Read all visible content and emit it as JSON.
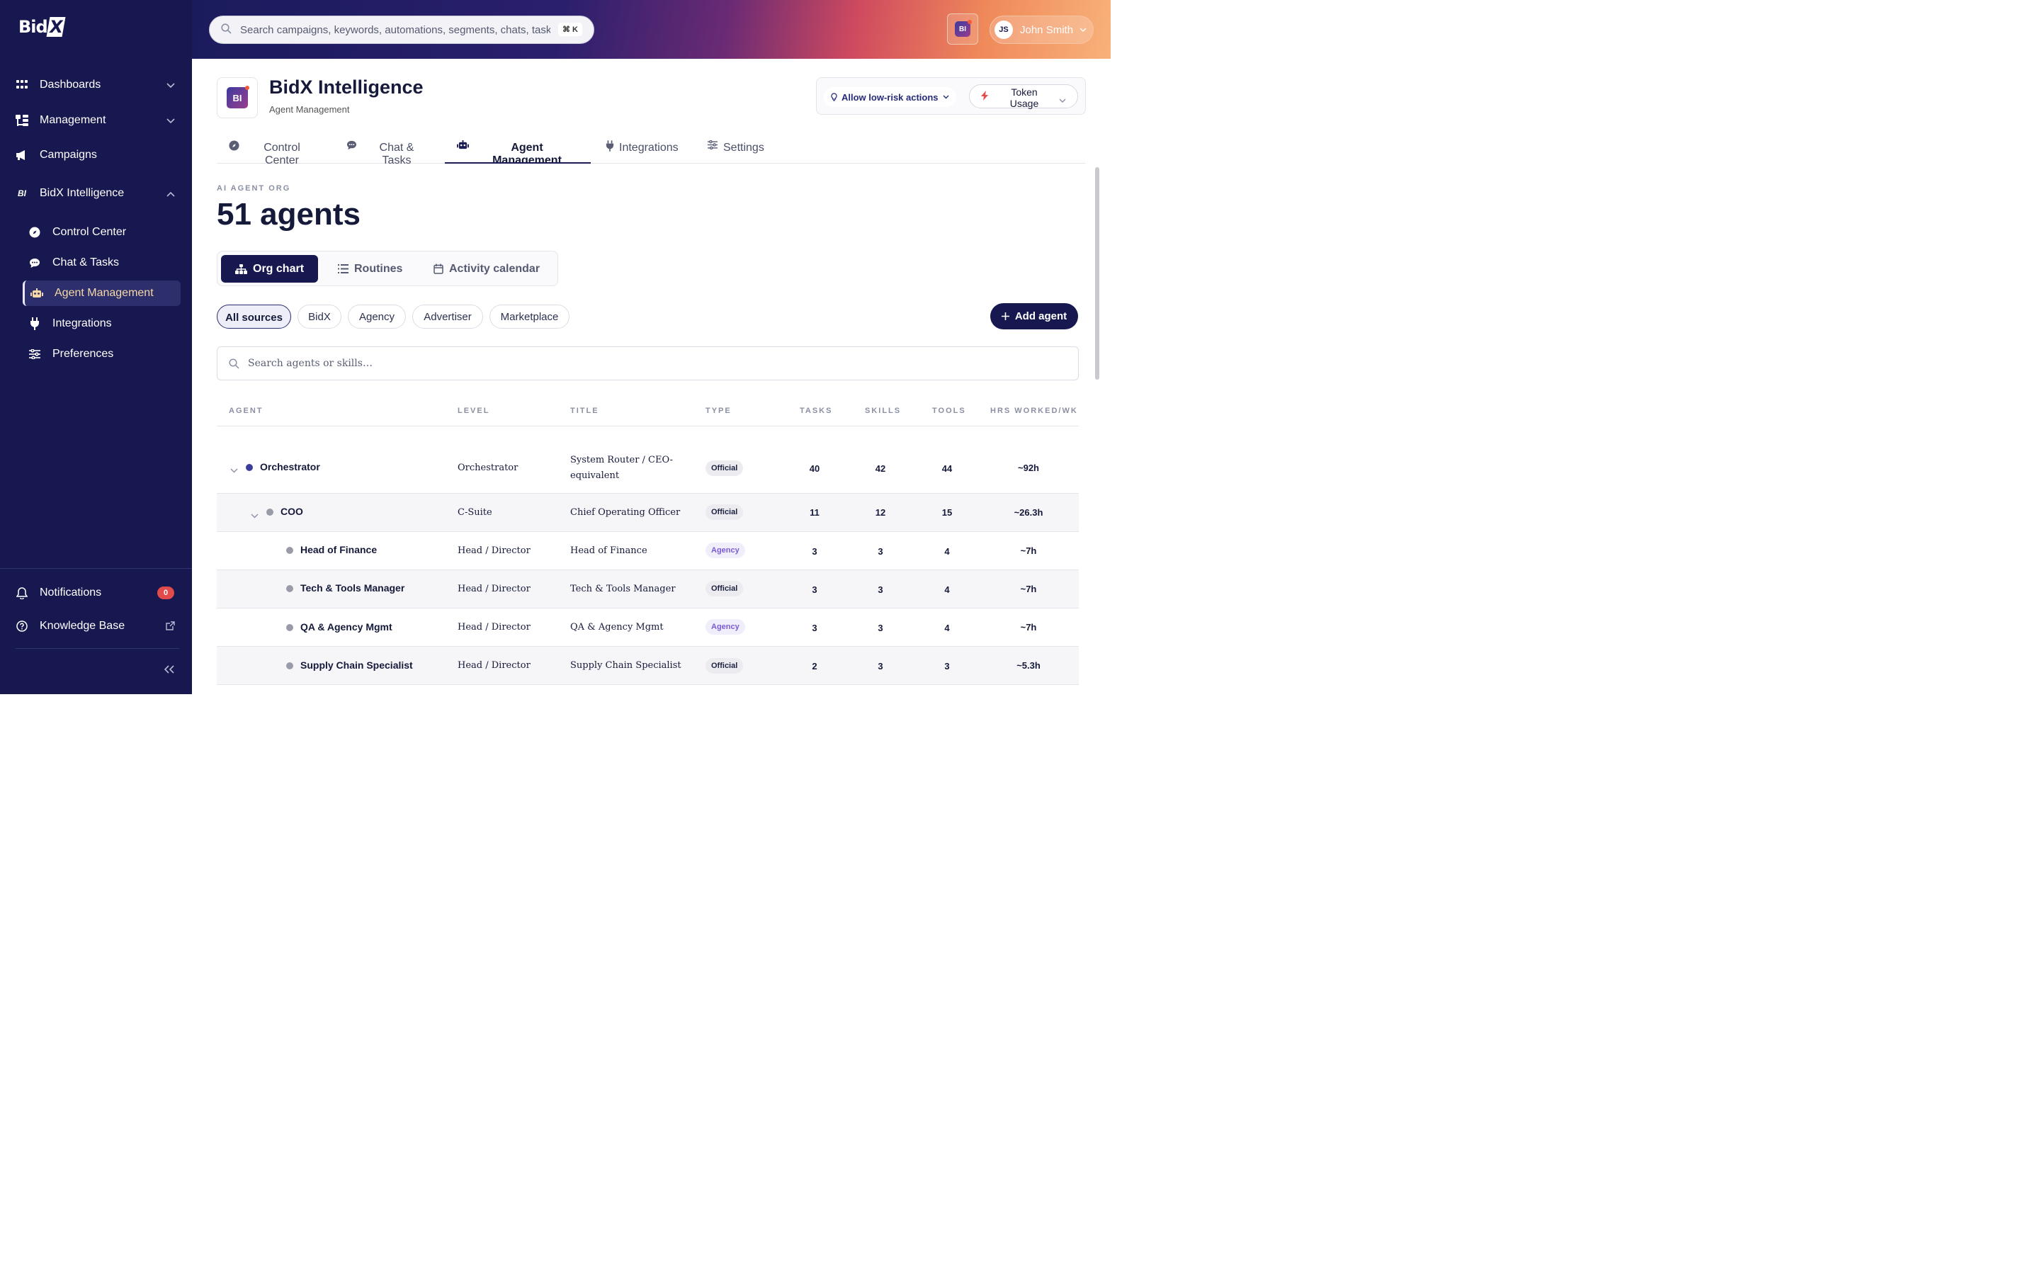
{
  "app": {
    "logo": "Bid",
    "logo_x": "X"
  },
  "sidebar": {
    "items": [
      {
        "label": "Dashboards",
        "icon": "grid-icon"
      },
      {
        "label": "Management",
        "icon": "org-icon"
      },
      {
        "label": "Campaigns",
        "icon": "megaphone-icon"
      },
      {
        "label": "BidX Intelligence",
        "icon": "bi-icon",
        "icon_text": "BI"
      }
    ],
    "sub_items": [
      {
        "label": "Control Center",
        "icon": "compass-icon"
      },
      {
        "label": "Chat & Tasks",
        "icon": "chat-icon"
      },
      {
        "label": "Agent Management",
        "icon": "robot-icon",
        "active": true
      },
      {
        "label": "Integrations",
        "icon": "plug-icon"
      },
      {
        "label": "Preferences",
        "icon": "sliders-icon"
      }
    ],
    "notifications": {
      "label": "Notifications",
      "count": "0"
    },
    "knowledge_base": {
      "label": "Knowledge Base"
    }
  },
  "header": {
    "search_placeholder": "Search campaigns, keywords, automations, segments, chats, tasks…",
    "shortcut": "⌘ K",
    "bi_badge": "BI",
    "user": {
      "initials": "JS",
      "name": "John Smith"
    }
  },
  "page": {
    "icon_text": "BI",
    "title": "BidX Intelligence",
    "subtitle": "Agent Management",
    "allow_label": "Allow low-risk actions",
    "token_label": "Token Usage"
  },
  "tabs": [
    {
      "label": "Control Center"
    },
    {
      "label": "Chat & Tasks"
    },
    {
      "label": "Agent Management",
      "active": true
    },
    {
      "label": "Integrations"
    },
    {
      "label": "Settings"
    }
  ],
  "org": {
    "kicker": "AI AGENT ORG",
    "count_label": "51 agents",
    "views": [
      {
        "label": "Org chart",
        "active": true
      },
      {
        "label": "Routines"
      },
      {
        "label": "Activity calendar"
      }
    ],
    "filters": [
      {
        "label": "All sources",
        "active": true
      },
      {
        "label": "BidX"
      },
      {
        "label": "Agency"
      },
      {
        "label": "Advertiser"
      },
      {
        "label": "Marketplace"
      }
    ],
    "add_label": "Add agent",
    "search_placeholder": "Search agents or skills…"
  },
  "table": {
    "headers": {
      "agent": "AGENT",
      "level": "LEVEL",
      "title": "TITLE",
      "type": "TYPE",
      "tasks": "TASKS",
      "skills": "SKILLS",
      "tools": "TOOLS",
      "hours": "HRS WORKED/WK"
    },
    "rows": [
      {
        "name": "Orchestrator",
        "level": "Orchestrator",
        "title": "System Router / CEO-equivalent",
        "type": "Official",
        "tasks": "40",
        "skills": "42",
        "tools": "44",
        "hours": "~92h"
      },
      {
        "name": "COO",
        "level": "C-Suite",
        "title": "Chief Operating Officer",
        "type": "Official",
        "tasks": "11",
        "skills": "12",
        "tools": "15",
        "hours": "~26.3h"
      },
      {
        "name": "Head of Finance",
        "level": "Head / Director",
        "title": "Head of Finance",
        "type": "Agency",
        "tasks": "3",
        "skills": "3",
        "tools": "4",
        "hours": "~7h"
      },
      {
        "name": "Tech & Tools Manager",
        "level": "Head / Director",
        "title": "Tech & Tools Manager",
        "type": "Official",
        "tasks": "3",
        "skills": "3",
        "tools": "4",
        "hours": "~7h"
      },
      {
        "name": "QA & Agency Mgmt",
        "level": "Head / Director",
        "title": "QA & Agency Mgmt",
        "type": "Agency",
        "tasks": "3",
        "skills": "3",
        "tools": "4",
        "hours": "~7h"
      },
      {
        "name": "Supply Chain Specialist",
        "level": "Head / Director",
        "title": "Supply Chain Specialist",
        "type": "Official",
        "tasks": "2",
        "skills": "3",
        "tools": "3",
        "hours": "~5.3h"
      }
    ]
  },
  "colors": {
    "sidebar_bg": "#17184f",
    "accent": "#17184f",
    "official_bg": "#ececf0",
    "agency_text": "#7a5bd6",
    "badge": "#e14b4b"
  }
}
